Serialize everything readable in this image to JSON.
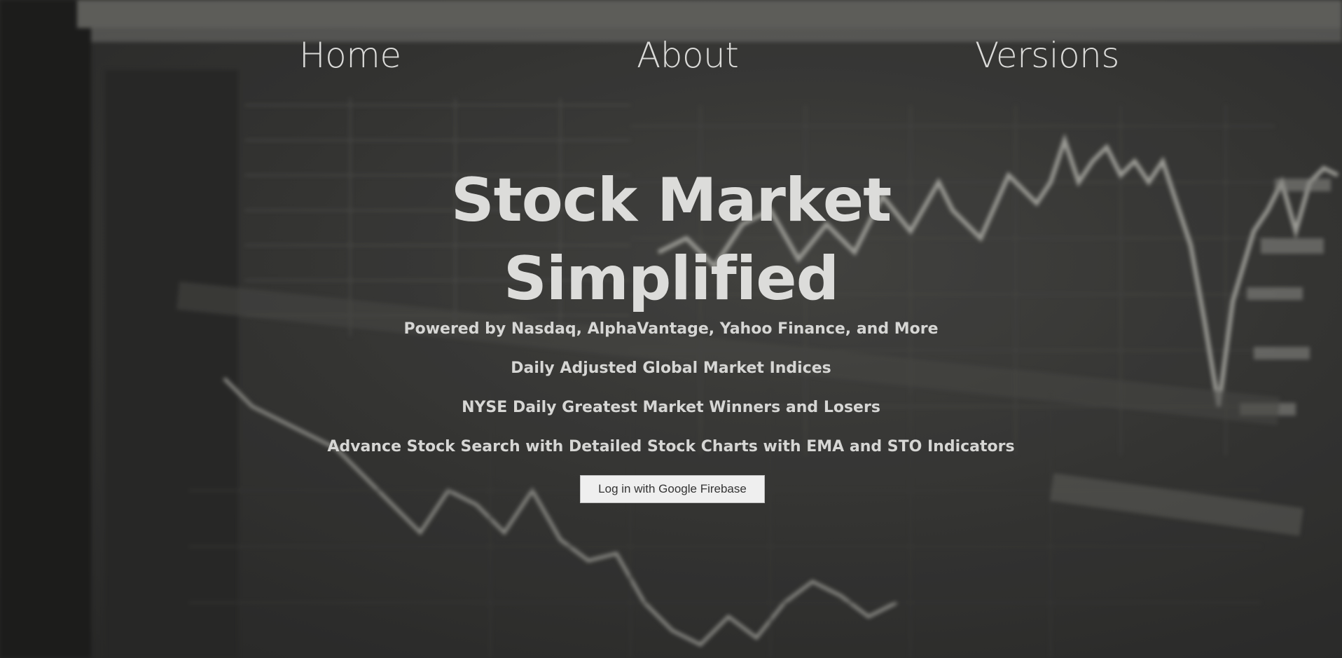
{
  "nav": {
    "items": [
      {
        "label": "Home"
      },
      {
        "label": "About"
      },
      {
        "label": "Versions"
      }
    ]
  },
  "hero": {
    "title_line1": "Stock Market",
    "title_line2": "Simplified",
    "features": [
      "Powered by Nasdaq, AlphaVantage, Yahoo Finance, and More",
      "Daily Adjusted Global Market Indices",
      "NYSE Daily Greatest Market Winners and Losers",
      "Advance Stock Search with Detailed Stock Charts with EMA and STO Indicators"
    ],
    "login_label": "Log in with Google Firebase"
  },
  "colors": {
    "text": "#dcdcda",
    "background": "#3a3a38",
    "button_bg": "#efefef"
  }
}
